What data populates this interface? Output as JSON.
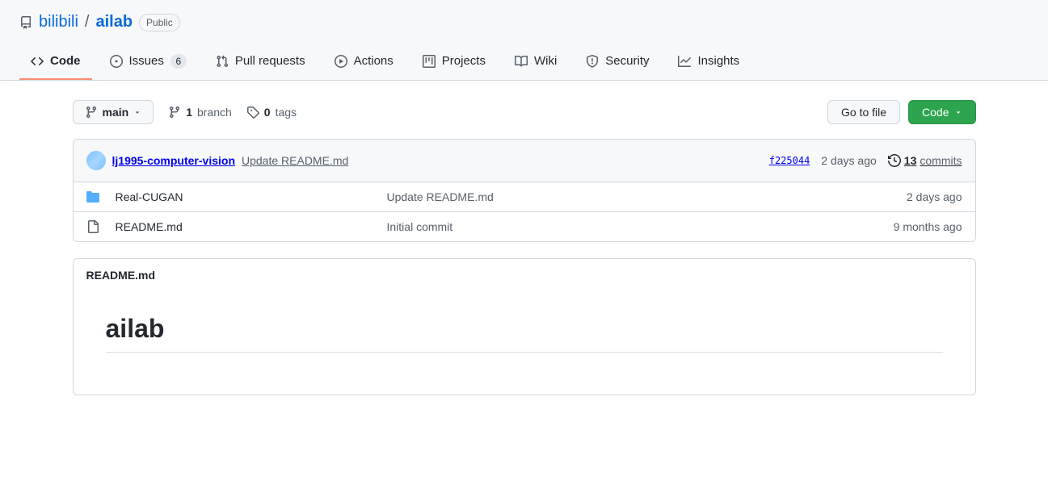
{
  "breadcrumb": {
    "owner": "bilibili",
    "separator": "/",
    "repo": "ailab",
    "visibility": "Public"
  },
  "tabs": {
    "code": "Code",
    "issues": "Issues",
    "issues_count": "6",
    "pulls": "Pull requests",
    "actions": "Actions",
    "projects": "Projects",
    "wiki": "Wiki",
    "security": "Security",
    "insights": "Insights"
  },
  "controls": {
    "branch": "main",
    "branches_count": "1",
    "branches_label": "branch",
    "tags_count": "0",
    "tags_label": "tags",
    "goto_file": "Go to file",
    "code_button": "Code"
  },
  "latest_commit": {
    "author": "lj1995-computer-vision",
    "message": "Update README.md",
    "sha": "f225044",
    "time": "2 days ago",
    "commits_count": "13",
    "commits_label": "commits"
  },
  "files": [
    {
      "type": "dir",
      "name": "Real-CUGAN",
      "message": "Update README.md",
      "time": "2 days ago"
    },
    {
      "type": "file",
      "name": "README.md",
      "message": "Initial commit",
      "time": "9 months ago"
    }
  ],
  "readme": {
    "filename": "README.md",
    "heading": "ailab"
  }
}
